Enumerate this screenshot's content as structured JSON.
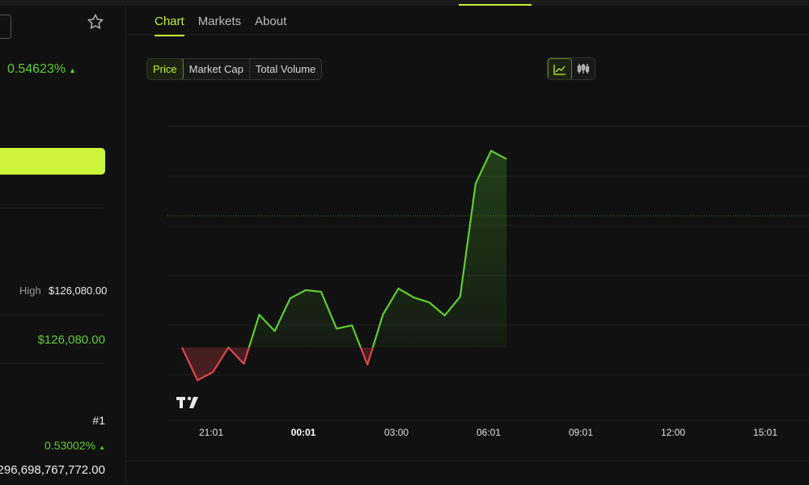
{
  "tabs": [
    {
      "label": "Chart",
      "active": true
    },
    {
      "label": "Markets",
      "active": false
    },
    {
      "label": "About",
      "active": false
    }
  ],
  "chart_controls": {
    "metric_options": [
      "Price",
      "Market Cap",
      "Total Volume"
    ],
    "selected_metric": "Price",
    "chart_styles": [
      "line-chart-icon",
      "candlestick-icon"
    ],
    "selected_style": "line-chart-icon"
  },
  "left_panel": {
    "change_pct": "0.54623%",
    "high_label": "High",
    "high_value": "$126,080.00",
    "green_value": "$126,080.00",
    "rank": "#1",
    "change_pct_2": "0.53002%",
    "big_value": "296,698,767,772.00"
  },
  "colors": {
    "accent": "#c7f02f",
    "up": "#5fce2f",
    "down": "#e0454b",
    "background": "#111111"
  },
  "chart_data": {
    "type": "line",
    "x_tick_labels": [
      "21:01",
      "00:01",
      "03:00",
      "06:01",
      "09:01",
      "12:00",
      "15:01"
    ],
    "bold_ticks": [
      "00:01"
    ],
    "baseline_index": 0,
    "series": [
      {
        "values": [
          100,
          96,
          97,
          100,
          98,
          104,
          102,
          106,
          107,
          106.8,
          102.3,
          102.7,
          97.9,
          104,
          107.2,
          106.1,
          105.5,
          103.9,
          106.2,
          120,
          124,
          123
        ]
      }
    ],
    "grid": true
  }
}
